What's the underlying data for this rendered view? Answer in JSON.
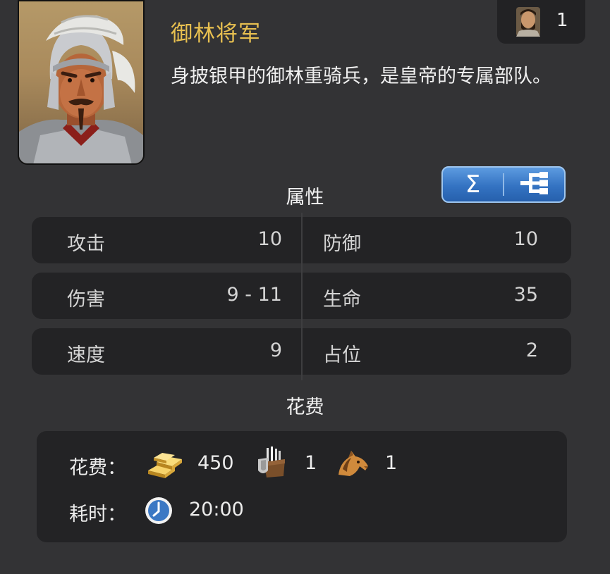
{
  "unit": {
    "name": "御林将军",
    "description": "身披银甲的御林重骑兵，是皇帝的专属部队。",
    "count": "1"
  },
  "toolbar": {
    "sum_button_symbol": "Σ",
    "tree_button_icon": "tree-structure-icon"
  },
  "attributes": {
    "title": "属性",
    "rows": [
      {
        "left_label": "攻击",
        "left_value": "10",
        "right_label": "防御",
        "right_value": "10"
      },
      {
        "left_label": "伤害",
        "left_value": "9 - 11",
        "right_label": "生命",
        "right_value": "35"
      },
      {
        "left_label": "速度",
        "left_value": "9",
        "right_label": "占位",
        "right_value": "2"
      }
    ]
  },
  "cost": {
    "title": "花费",
    "cost_label": "花费：",
    "gold_amount": "450",
    "weapons_amount": "1",
    "horse_amount": "1",
    "time_label": "耗时：",
    "time_value": "20:00"
  },
  "colors": {
    "background": "#333335",
    "panel": "#232325",
    "name_gold": "#e8c050",
    "button_blue": "#3473c2"
  }
}
